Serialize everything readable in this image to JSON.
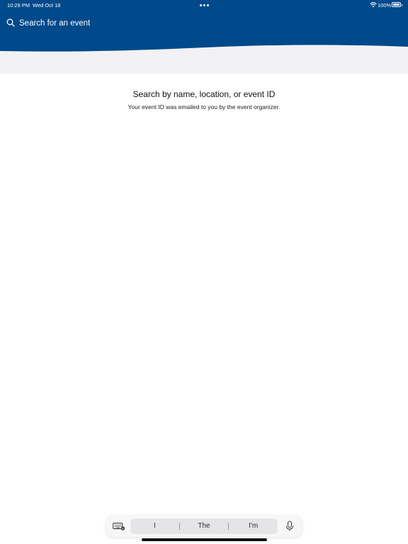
{
  "status_bar": {
    "time": "10:28 PM",
    "date": "Wed Oct 18",
    "battery_percent": "100%",
    "battery_level": 1.0,
    "icons": [
      "multitasking-dots-icon",
      "wifi-icon",
      "battery-icon"
    ]
  },
  "header": {
    "brand_color": "#00498a",
    "search": {
      "placeholder": "Search for an event",
      "value": "",
      "icon": "search-icon"
    }
  },
  "empty_state": {
    "title": "Search by name, location, or event ID",
    "subtitle": "Your event ID was emailed to you by the event organizer."
  },
  "keyboard_toolbar": {
    "icons": [
      "keyboard-icon",
      "microphone-icon"
    ],
    "suggestions": [
      "I",
      "The",
      "I'm"
    ]
  }
}
